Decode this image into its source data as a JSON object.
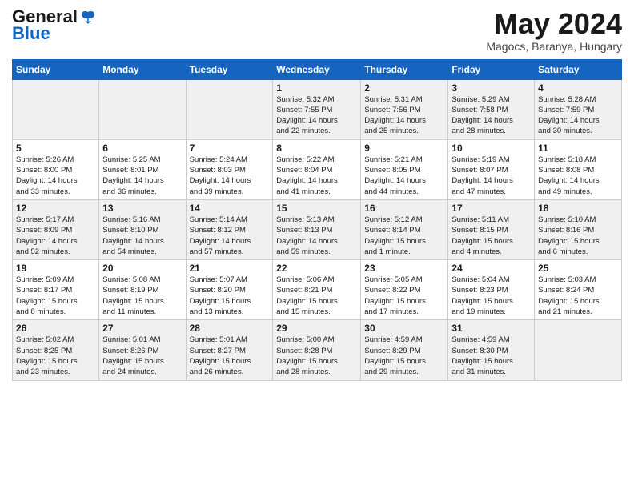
{
  "header": {
    "logo_line1": "General",
    "logo_line2": "Blue",
    "month": "May 2024",
    "location": "Magocs, Baranya, Hungary"
  },
  "days_of_week": [
    "Sunday",
    "Monday",
    "Tuesday",
    "Wednesday",
    "Thursday",
    "Friday",
    "Saturday"
  ],
  "weeks": [
    [
      {
        "num": "",
        "info": ""
      },
      {
        "num": "",
        "info": ""
      },
      {
        "num": "",
        "info": ""
      },
      {
        "num": "1",
        "info": "Sunrise: 5:32 AM\nSunset: 7:55 PM\nDaylight: 14 hours\nand 22 minutes."
      },
      {
        "num": "2",
        "info": "Sunrise: 5:31 AM\nSunset: 7:56 PM\nDaylight: 14 hours\nand 25 minutes."
      },
      {
        "num": "3",
        "info": "Sunrise: 5:29 AM\nSunset: 7:58 PM\nDaylight: 14 hours\nand 28 minutes."
      },
      {
        "num": "4",
        "info": "Sunrise: 5:28 AM\nSunset: 7:59 PM\nDaylight: 14 hours\nand 30 minutes."
      }
    ],
    [
      {
        "num": "5",
        "info": "Sunrise: 5:26 AM\nSunset: 8:00 PM\nDaylight: 14 hours\nand 33 minutes."
      },
      {
        "num": "6",
        "info": "Sunrise: 5:25 AM\nSunset: 8:01 PM\nDaylight: 14 hours\nand 36 minutes."
      },
      {
        "num": "7",
        "info": "Sunrise: 5:24 AM\nSunset: 8:03 PM\nDaylight: 14 hours\nand 39 minutes."
      },
      {
        "num": "8",
        "info": "Sunrise: 5:22 AM\nSunset: 8:04 PM\nDaylight: 14 hours\nand 41 minutes."
      },
      {
        "num": "9",
        "info": "Sunrise: 5:21 AM\nSunset: 8:05 PM\nDaylight: 14 hours\nand 44 minutes."
      },
      {
        "num": "10",
        "info": "Sunrise: 5:19 AM\nSunset: 8:07 PM\nDaylight: 14 hours\nand 47 minutes."
      },
      {
        "num": "11",
        "info": "Sunrise: 5:18 AM\nSunset: 8:08 PM\nDaylight: 14 hours\nand 49 minutes."
      }
    ],
    [
      {
        "num": "12",
        "info": "Sunrise: 5:17 AM\nSunset: 8:09 PM\nDaylight: 14 hours\nand 52 minutes."
      },
      {
        "num": "13",
        "info": "Sunrise: 5:16 AM\nSunset: 8:10 PM\nDaylight: 14 hours\nand 54 minutes."
      },
      {
        "num": "14",
        "info": "Sunrise: 5:14 AM\nSunset: 8:12 PM\nDaylight: 14 hours\nand 57 minutes."
      },
      {
        "num": "15",
        "info": "Sunrise: 5:13 AM\nSunset: 8:13 PM\nDaylight: 14 hours\nand 59 minutes."
      },
      {
        "num": "16",
        "info": "Sunrise: 5:12 AM\nSunset: 8:14 PM\nDaylight: 15 hours\nand 1 minute."
      },
      {
        "num": "17",
        "info": "Sunrise: 5:11 AM\nSunset: 8:15 PM\nDaylight: 15 hours\nand 4 minutes."
      },
      {
        "num": "18",
        "info": "Sunrise: 5:10 AM\nSunset: 8:16 PM\nDaylight: 15 hours\nand 6 minutes."
      }
    ],
    [
      {
        "num": "19",
        "info": "Sunrise: 5:09 AM\nSunset: 8:17 PM\nDaylight: 15 hours\nand 8 minutes."
      },
      {
        "num": "20",
        "info": "Sunrise: 5:08 AM\nSunset: 8:19 PM\nDaylight: 15 hours\nand 11 minutes."
      },
      {
        "num": "21",
        "info": "Sunrise: 5:07 AM\nSunset: 8:20 PM\nDaylight: 15 hours\nand 13 minutes."
      },
      {
        "num": "22",
        "info": "Sunrise: 5:06 AM\nSunset: 8:21 PM\nDaylight: 15 hours\nand 15 minutes."
      },
      {
        "num": "23",
        "info": "Sunrise: 5:05 AM\nSunset: 8:22 PM\nDaylight: 15 hours\nand 17 minutes."
      },
      {
        "num": "24",
        "info": "Sunrise: 5:04 AM\nSunset: 8:23 PM\nDaylight: 15 hours\nand 19 minutes."
      },
      {
        "num": "25",
        "info": "Sunrise: 5:03 AM\nSunset: 8:24 PM\nDaylight: 15 hours\nand 21 minutes."
      }
    ],
    [
      {
        "num": "26",
        "info": "Sunrise: 5:02 AM\nSunset: 8:25 PM\nDaylight: 15 hours\nand 23 minutes."
      },
      {
        "num": "27",
        "info": "Sunrise: 5:01 AM\nSunset: 8:26 PM\nDaylight: 15 hours\nand 24 minutes."
      },
      {
        "num": "28",
        "info": "Sunrise: 5:01 AM\nSunset: 8:27 PM\nDaylight: 15 hours\nand 26 minutes."
      },
      {
        "num": "29",
        "info": "Sunrise: 5:00 AM\nSunset: 8:28 PM\nDaylight: 15 hours\nand 28 minutes."
      },
      {
        "num": "30",
        "info": "Sunrise: 4:59 AM\nSunset: 8:29 PM\nDaylight: 15 hours\nand 29 minutes."
      },
      {
        "num": "31",
        "info": "Sunrise: 4:59 AM\nSunset: 8:30 PM\nDaylight: 15 hours\nand 31 minutes."
      },
      {
        "num": "",
        "info": ""
      }
    ]
  ]
}
